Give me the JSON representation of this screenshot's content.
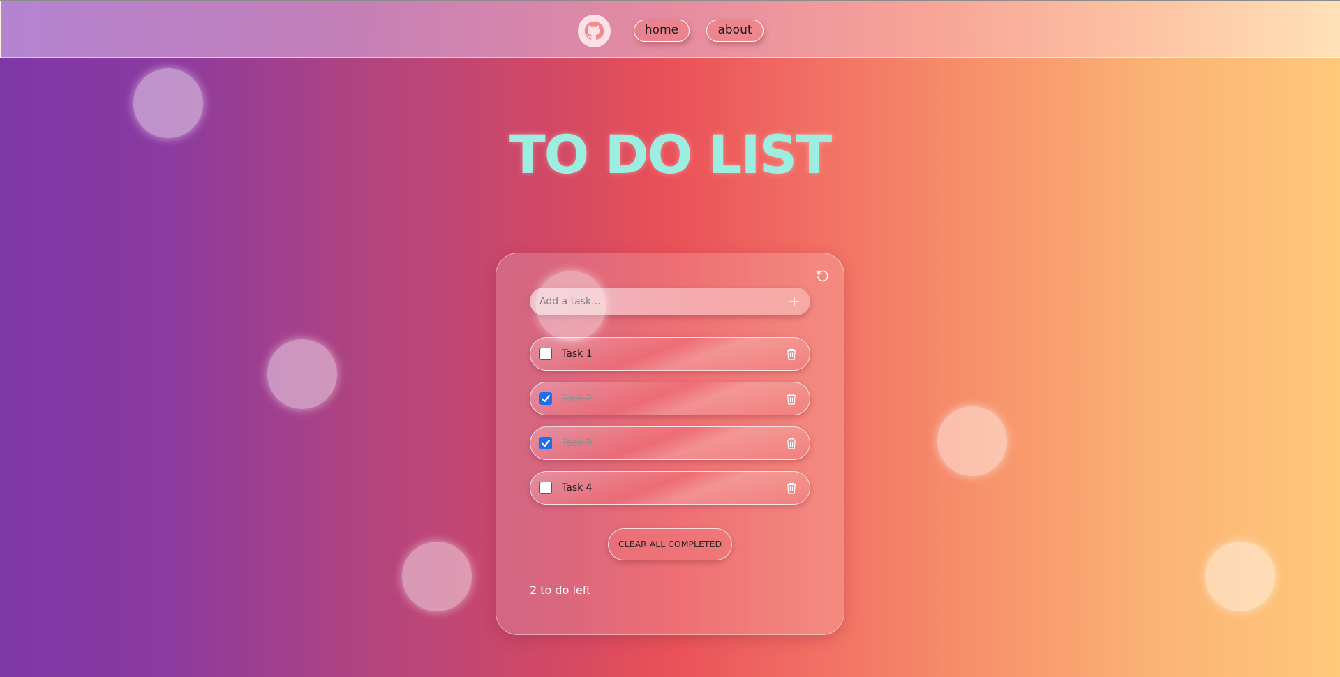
{
  "nav": {
    "logo_icon": "github-icon",
    "home_label": "home",
    "about_label": "about"
  },
  "title": "TO DO LIST",
  "todo": {
    "reset_icon": "reset-icon",
    "input": {
      "placeholder": "Add a task...",
      "value": ""
    },
    "add_icon": "plus-icon",
    "tasks": [
      {
        "label": "Task 1",
        "completed": false
      },
      {
        "label": "Task 2",
        "completed": true
      },
      {
        "label": "Task 3",
        "completed": true
      },
      {
        "label": "Task 4",
        "completed": false
      }
    ],
    "delete_icon": "trash-icon",
    "clear_label": "CLEAR ALL COMPLETED",
    "left_text": "2 to do left"
  },
  "colors": {
    "title": "#9ceee0",
    "checkbox_checked": "#1e6ef0"
  }
}
